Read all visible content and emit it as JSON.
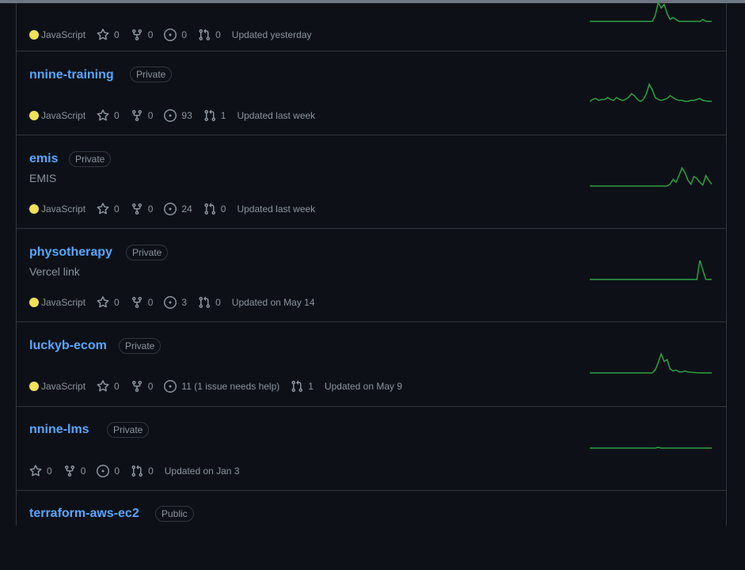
{
  "colors": {
    "background": "#0d1117",
    "link": "#58a6ff",
    "muted": "#8b949e",
    "border": "#30363d",
    "javascript": "#f1e05a",
    "sparkline": "#2ea043"
  },
  "icons": [
    "star-icon",
    "fork-icon",
    "issue-opened-icon",
    "pull-request-icon"
  ],
  "repos": [
    {
      "name": "",
      "visibility": "",
      "description": "",
      "language": "JavaScript",
      "stars": "0",
      "forks": "0",
      "issues": "0",
      "pulls": "0",
      "updated": "Updated yesterday"
    },
    {
      "name": "nnine-training",
      "visibility": "Private",
      "description": "",
      "language": "JavaScript",
      "stars": "0",
      "forks": "0",
      "issues": "93",
      "pulls": "1",
      "updated": "Updated last week"
    },
    {
      "name": "emis",
      "visibility": "Private",
      "description": "EMIS",
      "language": "JavaScript",
      "stars": "0",
      "forks": "0",
      "issues": "24",
      "pulls": "0",
      "updated": "Updated last week"
    },
    {
      "name": "physotherapy",
      "visibility": "Private",
      "description": "Vercel link",
      "language": "JavaScript",
      "stars": "0",
      "forks": "0",
      "issues": "3",
      "pulls": "0",
      "updated": "Updated on May 14"
    },
    {
      "name": "luckyb-ecom",
      "visibility": "Private",
      "description": "",
      "language": "JavaScript",
      "stars": "0",
      "forks": "0",
      "issues": "11 (1 issue needs help)",
      "pulls": "1",
      "updated": "Updated on May 9"
    },
    {
      "name": "nnine-lms",
      "visibility": "Private",
      "description": "",
      "language": "",
      "stars": "0",
      "forks": "0",
      "issues": "0",
      "pulls": "0",
      "updated": "Updated on Jan 3"
    },
    {
      "name": "terraform-aws-ec2",
      "visibility": "Public",
      "description": "",
      "language": "",
      "stars": "",
      "forks": "",
      "issues": "",
      "pulls": "",
      "updated": ""
    }
  ],
  "activity": [
    [
      0,
      0,
      0,
      0,
      0,
      0,
      0,
      0,
      0,
      0,
      0,
      0,
      0,
      0,
      0,
      0,
      0,
      0,
      0,
      0,
      0,
      0,
      0.3,
      1,
      0.7,
      0.9,
      0.4,
      0.1,
      0.2,
      0.1,
      0,
      0,
      0,
      0,
      0,
      0,
      0,
      0,
      0.1,
      0,
      0,
      0
    ],
    [
      0,
      0.1,
      0.15,
      0.05,
      0.1,
      0.1,
      0.2,
      0.1,
      0.05,
      0.2,
      0.1,
      0.05,
      0.1,
      0.2,
      0.4,
      0.3,
      0.1,
      0,
      0.1,
      0.4,
      0.9,
      0.6,
      0.2,
      0.1,
      0.05,
      0.1,
      0.15,
      0.3,
      0.2,
      0.1,
      0.05,
      0.05,
      0,
      0,
      0.05,
      0.05,
      0.1,
      0.15,
      0.05,
      0.02,
      0,
      0
    ],
    [
      0,
      0,
      0,
      0,
      0,
      0,
      0,
      0,
      0,
      0,
      0,
      0,
      0,
      0,
      0,
      0,
      0,
      0,
      0,
      0,
      0,
      0,
      0,
      0,
      0,
      0,
      0,
      0.1,
      0.35,
      0.2,
      0.55,
      0.95,
      0.7,
      0.3,
      0.1,
      0.5,
      0.4,
      0.2,
      0.05,
      0.55,
      0.3,
      0.1
    ],
    [
      0,
      0,
      0,
      0,
      0,
      0,
      0,
      0,
      0,
      0,
      0,
      0,
      0,
      0,
      0,
      0,
      0,
      0,
      0,
      0,
      0,
      0,
      0,
      0,
      0,
      0,
      0,
      0,
      0,
      0,
      0,
      0,
      0,
      0,
      0,
      0,
      0,
      1,
      0.5,
      0,
      0,
      0
    ],
    [
      0,
      0,
      0,
      0,
      0,
      0,
      0,
      0,
      0,
      0,
      0,
      0,
      0,
      0,
      0,
      0,
      0,
      0,
      0,
      0,
      0,
      0,
      0.15,
      0.55,
      1,
      0.6,
      0.7,
      0.2,
      0.1,
      0.15,
      0.05,
      0.05,
      0.1,
      0.05,
      0.03,
      0.02,
      0.01,
      0,
      0,
      0,
      0,
      0
    ],
    [
      0,
      0,
      0,
      0,
      0,
      0,
      0,
      0,
      0,
      0,
      0,
      0,
      0,
      0,
      0,
      0,
      0,
      0,
      0,
      0,
      0,
      0,
      0,
      0.04,
      0,
      0,
      0,
      0,
      0,
      0,
      0,
      0,
      0,
      0,
      0,
      0,
      0,
      0,
      0,
      0,
      0,
      0
    ],
    []
  ]
}
